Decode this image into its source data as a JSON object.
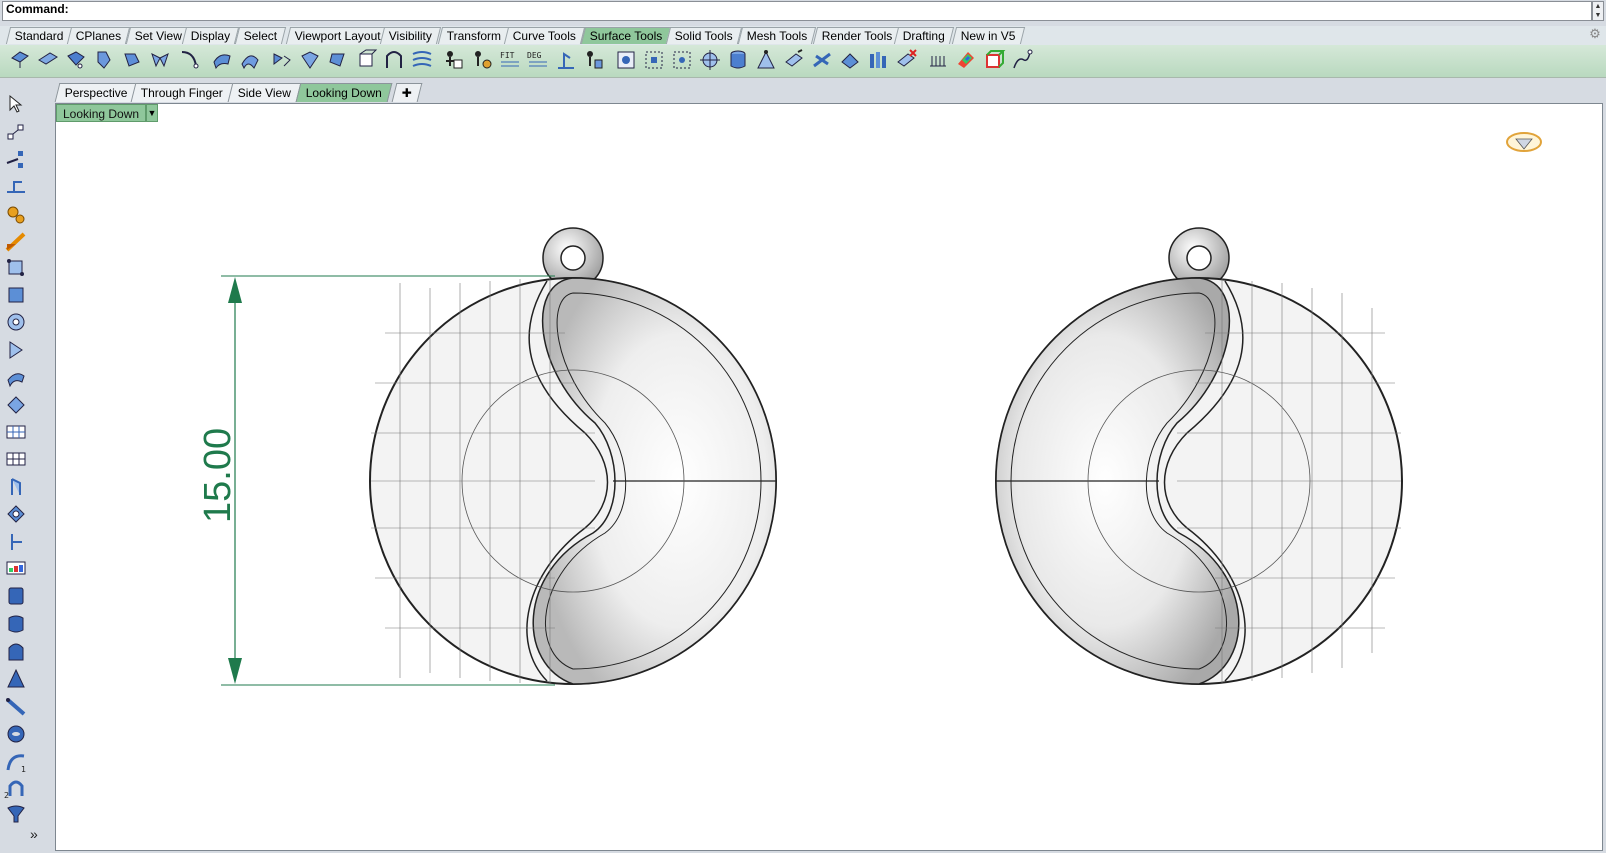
{
  "command": {
    "label": "Command:"
  },
  "menu_tabs": [
    {
      "label": "Standard",
      "active": false
    },
    {
      "label": "CPlanes",
      "active": false
    },
    {
      "label": "Set View",
      "active": false
    },
    {
      "label": "Display",
      "active": false
    },
    {
      "label": "Select",
      "active": false
    },
    {
      "label": "Viewport Layout",
      "active": false
    },
    {
      "label": "Visibility",
      "active": false
    },
    {
      "label": "Transform",
      "active": false
    },
    {
      "label": "Curve Tools",
      "active": false
    },
    {
      "label": "Surface Tools",
      "active": true
    },
    {
      "label": "Solid Tools",
      "active": false
    },
    {
      "label": "Mesh Tools",
      "active": false
    },
    {
      "label": "Render Tools",
      "active": false
    },
    {
      "label": "Drafting",
      "active": false
    },
    {
      "label": "New in V5",
      "active": false
    }
  ],
  "toolbar_text": {
    "fit": "FIT",
    "deg": "DEG"
  },
  "viewport_tabs": [
    {
      "label": "Perspective",
      "active": false
    },
    {
      "label": "Through Finger",
      "active": false
    },
    {
      "label": "Side View",
      "active": false
    },
    {
      "label": "Looking Down",
      "active": true
    }
  ],
  "viewport": {
    "title": "Looking Down",
    "dimension_value": "15.00"
  },
  "left_toolbar": {
    "more": "»",
    "icon_label_1": "1",
    "icon_label_2": "2"
  },
  "colors": {
    "accent_tab": "#8fc79b",
    "dimension": "#1f7a4c",
    "toolbar_gradient_top": "#d5e8d8"
  }
}
